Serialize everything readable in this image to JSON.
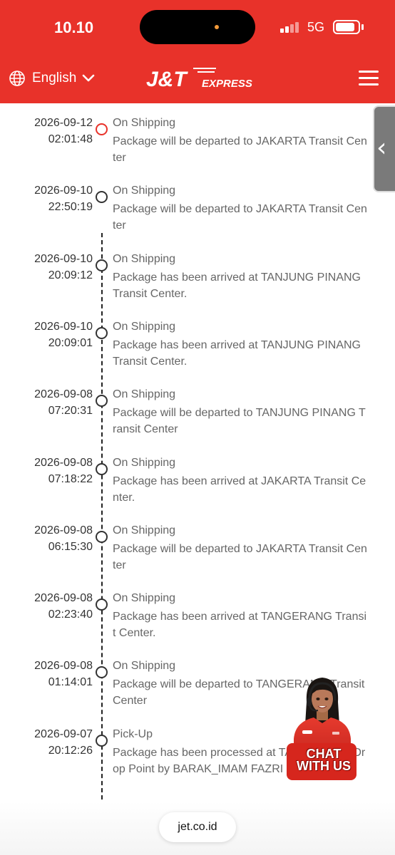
{
  "status_bar": {
    "time": "10.10",
    "network": "5G",
    "battery_level": 0.85
  },
  "header": {
    "language_label": "English",
    "logo_text": "J&T",
    "logo_subtext": "EXPRESS",
    "brand_color": "#e8322a"
  },
  "tracking": {
    "entries": [
      {
        "date": "2026-09-12",
        "time": "02:01:48",
        "status": "On Shipping",
        "description": "Package will be departed to JAKARTA Transit Center",
        "current": true
      },
      {
        "date": "2026-09-10",
        "time": "22:50:19",
        "status": "On Shipping",
        "description": "Package will be departed to JAKARTA Transit Center",
        "current": false
      },
      {
        "date": "2026-09-10",
        "time": "20:09:12",
        "status": "On Shipping",
        "description": "Package has been arrived at TANJUNG PINANG Transit Center.",
        "current": false
      },
      {
        "date": "2026-09-10",
        "time": "20:09:01",
        "status": "On Shipping",
        "description": "Package has been arrived at TANJUNG PINANG Transit Center.",
        "current": false
      },
      {
        "date": "2026-09-08",
        "time": "07:20:31",
        "status": "On Shipping",
        "description": "Package will be departed to TANJUNG PINANG Transit Center",
        "current": false
      },
      {
        "date": "2026-09-08",
        "time": "07:18:22",
        "status": "On Shipping",
        "description": "Package has been arrived at JAKARTA Transit Center.",
        "current": false
      },
      {
        "date": "2026-09-08",
        "time": "06:15:30",
        "status": "On Shipping",
        "description": "Package will be departed to JAKARTA Transit Center",
        "current": false
      },
      {
        "date": "2026-09-08",
        "time": "02:23:40",
        "status": "On Shipping",
        "description": "Package has been arrived at TANGERANG Transit Center.",
        "current": false
      },
      {
        "date": "2026-09-08",
        "time": "01:14:01",
        "status": "On Shipping",
        "description": "Package will be departed to TANGERANG Transit Center",
        "current": false
      },
      {
        "date": "2026-09-07",
        "time": "20:12:26",
        "status": "Pick-Up",
        "description": "Package has been processed at TANGERANG Drop Point by BARAK_IMAM FAZRI",
        "current": false
      }
    ]
  },
  "chat_widget": {
    "label_line1": "CHAT",
    "label_line2": "WITH US"
  },
  "browser": {
    "url": "jet.co.id"
  }
}
